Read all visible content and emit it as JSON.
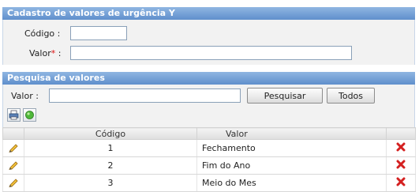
{
  "cadastro": {
    "title": "Cadastro de valores de urgência Y",
    "codigo_label": "Código :",
    "codigo_value": "",
    "valor_label": "Valor",
    "valor_required": "*",
    "valor_colon": " :",
    "valor_value": ""
  },
  "pesquisa": {
    "title": "Pesquisa de valores",
    "valor_label": "Valor :",
    "valor_value": "",
    "search_button": "Pesquisar",
    "all_button": "Todos",
    "toolbar_icons": [
      "print-icon",
      "green-circle-icon"
    ]
  },
  "table": {
    "columns": [
      "Código",
      "Valor"
    ],
    "rows": [
      {
        "codigo": "1",
        "valor": "Fechamento"
      },
      {
        "codigo": "2",
        "valor": "Fim do Ano"
      },
      {
        "codigo": "3",
        "valor": "Meio do Mes"
      }
    ],
    "edit_icon": "pencil-icon",
    "delete_icon": "red-x-icon"
  },
  "colors": {
    "header_gradient_top": "#8fb6e2",
    "header_gradient_bottom": "#5f8fcc",
    "required": "#dd1111",
    "delete": "#d42020"
  }
}
